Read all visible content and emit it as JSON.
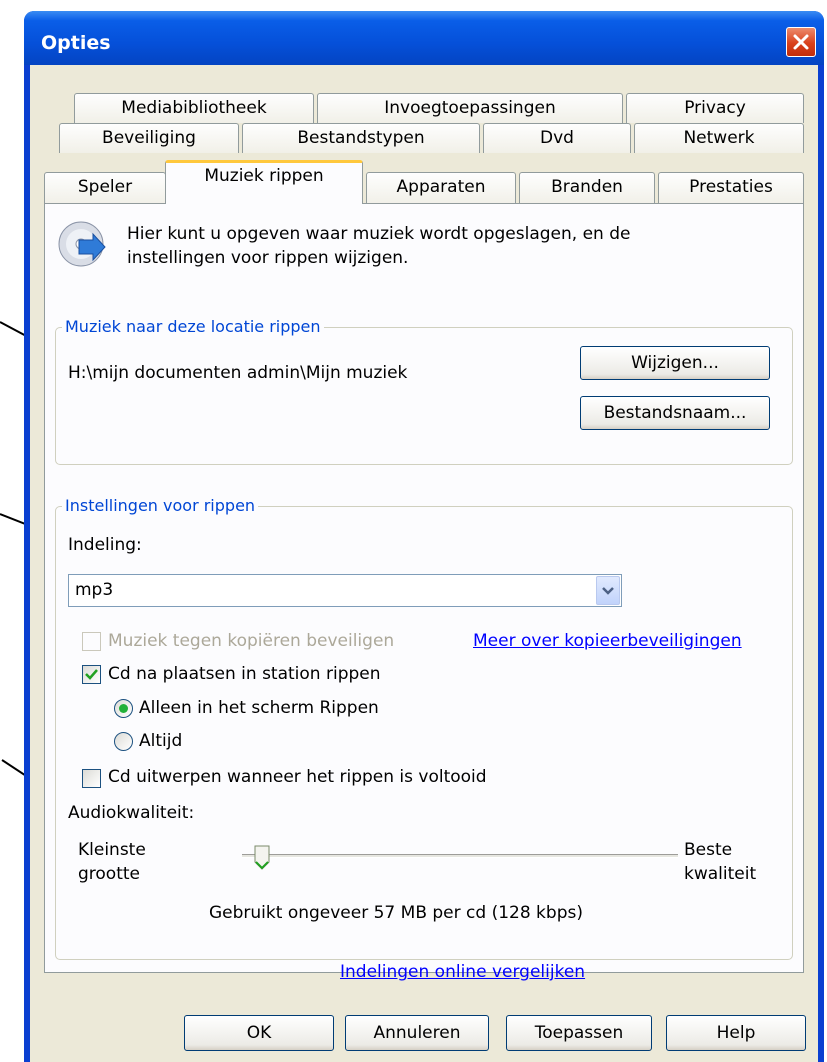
{
  "window": {
    "title": "Opties"
  },
  "tabs": {
    "row1": [
      "Mediabibliotheek",
      "Invoegtoepassingen",
      "Privacy"
    ],
    "row2": [
      "Beveiliging",
      "Bestandstypen",
      "Dvd",
      "Netwerk"
    ],
    "row3": [
      "Speler",
      "Muziek rippen",
      "Apparaten",
      "Branden",
      "Prestaties"
    ],
    "active": "Muziek rippen"
  },
  "intro": {
    "icon": "cd-rip-icon",
    "text_line1": "Hier kunt u opgeven waar muziek wordt opgeslagen, en de",
    "text_line2": "instellingen voor rippen wijzigen."
  },
  "location": {
    "group_label": "Muziek naar deze locatie rippen",
    "path": "H:\\mijn documenten admin\\Mijn muziek",
    "change_button": "Wijzigen...",
    "filename_button": "Bestandsnaam..."
  },
  "rip_settings": {
    "group_label": "Instellingen voor rippen",
    "format_label": "Indeling:",
    "format_value": "mp3",
    "copy_protect": {
      "label": "Muziek tegen kopiëren beveiligen",
      "checked": false,
      "disabled": true
    },
    "copy_protect_link": "Meer over kopieerbeveiligingen",
    "rip_on_insert": {
      "label": "Cd na plaatsen in station rippen",
      "checked": true
    },
    "radio_only_rip_screen": {
      "label": "Alleen in het scherm Rippen",
      "selected": true
    },
    "radio_always": {
      "label": "Altijd",
      "selected": false
    },
    "eject_after": {
      "label": "Cd uitwerpen wanneer het rippen is voltooid",
      "checked": false
    },
    "audio_quality_label": "Audiokwaliteit:",
    "slider_min_line1": "Kleinste",
    "slider_min_line2": "grootte",
    "slider_max_line1": "Beste",
    "slider_max_line2": "kwaliteit",
    "slider_level": 0.0,
    "size_info": "Gebruikt ongeveer 57 MB per cd (128 kbps)",
    "compare_link": "Indelingen online vergelijken"
  },
  "buttons": {
    "ok": "OK",
    "cancel": "Annuleren",
    "apply": "Toepassen",
    "help": "Help"
  },
  "colors": {
    "titlebar": "#0550d9",
    "dialog_bg": "#ece9d8",
    "group_label": "#0046d5",
    "link": "#0000ff",
    "active_tab_accent": "#ffc83c"
  }
}
